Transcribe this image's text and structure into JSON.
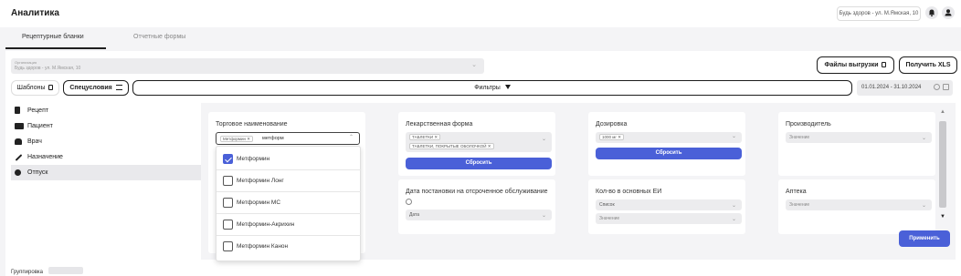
{
  "header": {
    "title": "Аналитика",
    "org_chip": "Будь здоров - ул. М.Ямская, 10"
  },
  "tabs": [
    {
      "label": "Рецептурные бланки"
    },
    {
      "label": "Отчетные формы"
    }
  ],
  "organization": {
    "label": "Организация",
    "value": "Будь здоров - ул. М.Ямская, 10"
  },
  "toolbar": {
    "files_label": "Файлы выгрузки",
    "get_xls_label": "Получить XLS",
    "templates_label": "Шаблоны",
    "conditions_label": "Спецусловия",
    "filters_label": "Фильтры",
    "date_range": "01.01.2024 - 31.10.2024"
  },
  "sidebar": {
    "items": [
      {
        "label": "Рецепт"
      },
      {
        "label": "Пациент"
      },
      {
        "label": "Врач"
      },
      {
        "label": "Назначение"
      },
      {
        "label": "Отпуск"
      }
    ]
  },
  "filters": {
    "trade_name": {
      "title": "Торговое наименование",
      "chip": "Метформин",
      "query": "метформ"
    },
    "dosage_form": {
      "title": "Лекарственная форма",
      "chips": [
        "ТАБЛЕТКИ",
        "ТАБЛЕТКИ, ПОКРЫТЫЕ ОБОЛОЧКОЙ"
      ],
      "reset_label": "Сбросить"
    },
    "dosage": {
      "title": "Дозировка",
      "chip": "1000 мг",
      "reset_label": "Сбросить"
    },
    "manufacturer": {
      "title": "Производитель",
      "placeholder": "Значение"
    },
    "deferred_date": {
      "title": "Дата постановки на отсроченное обслуживание",
      "select_value": "Дата"
    },
    "base_units": {
      "title": "Кол-во в основных ЕИ",
      "list_value": "Список",
      "placeholder": "Значение"
    },
    "pharmacy": {
      "title": "Аптека",
      "placeholder": "Значение"
    },
    "apply_label": "Применить"
  },
  "dropdown": {
    "options": [
      {
        "label": "Метформин",
        "checked": true
      },
      {
        "label": "Метформин Лонг",
        "checked": false
      },
      {
        "label": "Метформин МС",
        "checked": false
      },
      {
        "label": "Метформин-Акрихин",
        "checked": false
      },
      {
        "label": "Метформин Канон",
        "checked": false
      }
    ]
  },
  "bottom": {
    "group_label": "Группировка"
  },
  "colors": {
    "accent": "#4a60d8",
    "background": "#f4f4f6"
  }
}
